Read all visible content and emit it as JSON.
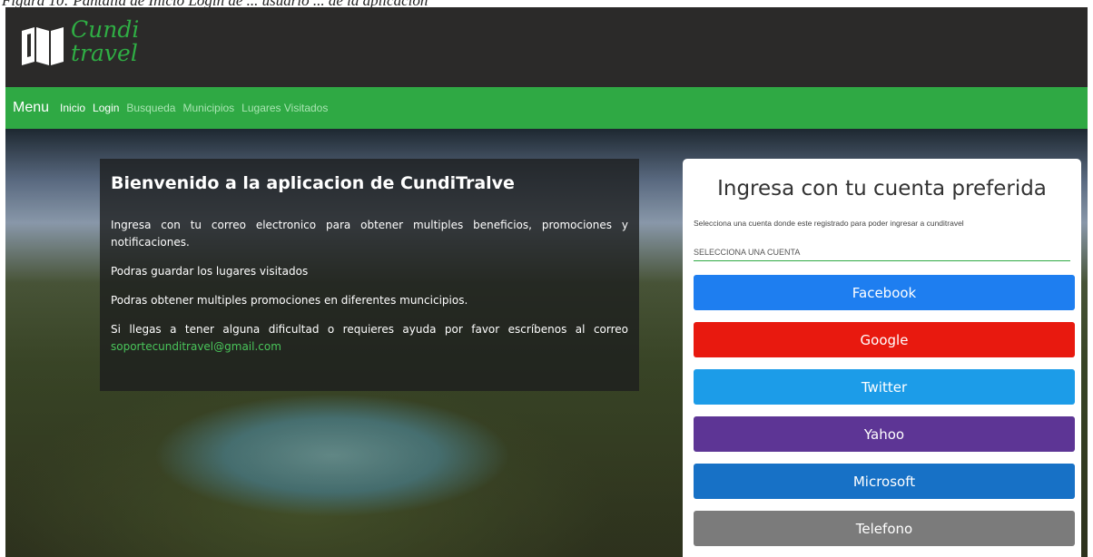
{
  "caption": "Figura 10: Pantalla de Inicio Login de ... usuario ... de la aplicacion",
  "header": {
    "logo_text_1": "Cundi",
    "logo_text_2": "travel",
    "logo_icon": "map-icon"
  },
  "navbar": {
    "brand": "Menu",
    "links": [
      "Inicio",
      "Login",
      "Busqueda",
      "Municipios",
      "Lugares Visitados"
    ]
  },
  "welcome": {
    "title": "Bienvenido a la aplicacion de CundiTralve",
    "p1": "Ingresa con tu correo electronico para obtener multiples beneficios, promociones y notificaciones.",
    "p2": "Podras guardar los lugares visitados",
    "p3": "Podras obtener multiples promociones en diferentes muncicipios.",
    "p4": "Si llegas a tener alguna dificultad o requieres ayuda por favor escríbenos al correo",
    "email": "soportecunditravel@gmail.com"
  },
  "login": {
    "title": "Ingresa con tu cuenta preferida",
    "subtitle": "Selecciona una cuenta donde este registrado para poder ingresar a cunditravel",
    "select_label": "SELECCIONA UNA CUENTA",
    "providers": [
      {
        "label": "Facebook",
        "color": "#1e7ef0"
      },
      {
        "label": "Google",
        "color": "#e8190f"
      },
      {
        "label": "Twitter",
        "color": "#1c9ce8"
      },
      {
        "label": "Yahoo",
        "color": "#5d3595"
      },
      {
        "label": "Microsoft",
        "color": "#1771c6"
      },
      {
        "label": "Telefono",
        "color": "#7b7b7b"
      }
    ]
  }
}
